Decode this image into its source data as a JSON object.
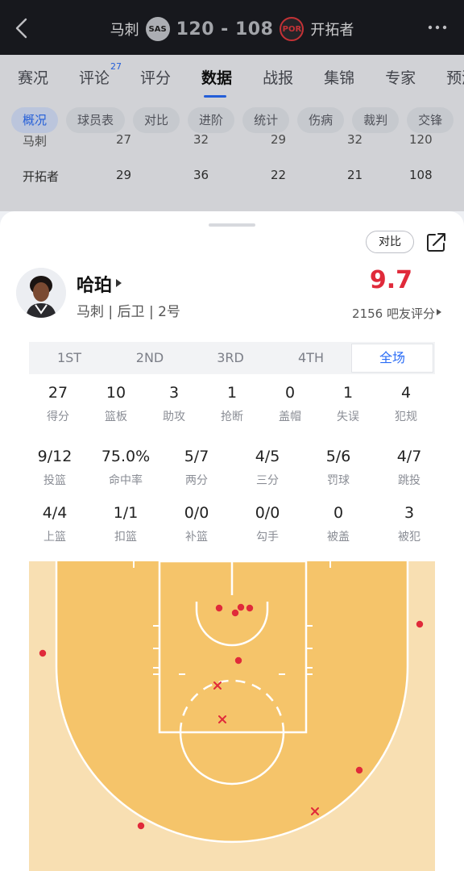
{
  "header": {
    "home_team": "马刺",
    "home_logo": "SAS",
    "score": "120 - 108",
    "away_logo": "POR",
    "away_team": "开拓者"
  },
  "main_tabs": [
    {
      "label": "赛况"
    },
    {
      "label": "评论",
      "badge": "27"
    },
    {
      "label": "评分"
    },
    {
      "label": "数据",
      "active": true
    },
    {
      "label": "战报"
    },
    {
      "label": "集锦"
    },
    {
      "label": "专家"
    },
    {
      "label": "预测"
    }
  ],
  "sub_tabs": [
    {
      "label": "概况",
      "active": true
    },
    {
      "label": "球员表"
    },
    {
      "label": "对比"
    },
    {
      "label": "进阶"
    },
    {
      "label": "统计"
    },
    {
      "label": "伤病"
    },
    {
      "label": "裁判"
    },
    {
      "label": "交锋"
    }
  ],
  "bg_table": {
    "row_clipped": {
      "team": "马刺",
      "values": [
        "27",
        "32",
        "29",
        "32",
        "120"
      ]
    },
    "row_por": {
      "team": "开拓者",
      "values": [
        "29",
        "36",
        "22",
        "21",
        "108"
      ]
    }
  },
  "sheet": {
    "compare_label": "对比",
    "player_name": "哈珀",
    "player_meta": "马刺 | 后卫 | 2号",
    "rating": "9.7",
    "rating_sub": "2156 吧友评分",
    "periods": [
      {
        "label": "1ST"
      },
      {
        "label": "2ND"
      },
      {
        "label": "3RD"
      },
      {
        "label": "4TH"
      },
      {
        "label": "全场",
        "active": true
      }
    ],
    "stats_row1": [
      {
        "value": "27",
        "label": "得分"
      },
      {
        "value": "10",
        "label": "篮板"
      },
      {
        "value": "3",
        "label": "助攻"
      },
      {
        "value": "1",
        "label": "抢断"
      },
      {
        "value": "0",
        "label": "盖帽"
      },
      {
        "value": "1",
        "label": "失误"
      },
      {
        "value": "4",
        "label": "犯规"
      }
    ],
    "stats_row2": [
      {
        "value": "9/12",
        "label": "投篮"
      },
      {
        "value": "75.0%",
        "label": "命中率"
      },
      {
        "value": "5/7",
        "label": "两分"
      },
      {
        "value": "4/5",
        "label": "三分"
      },
      {
        "value": "5/6",
        "label": "罚球"
      },
      {
        "value": "4/7",
        "label": "跳投"
      }
    ],
    "stats_row3": [
      {
        "value": "4/4",
        "label": "上篮"
      },
      {
        "value": "1/1",
        "label": "扣篮"
      },
      {
        "value": "0/0",
        "label": "补篮"
      },
      {
        "value": "0/0",
        "label": "勾手"
      },
      {
        "value": "0",
        "label": "被盖"
      },
      {
        "value": "3",
        "label": "被犯"
      }
    ]
  },
  "colors": {
    "accent": "#2a6cf6",
    "rating": "#e02a3a",
    "court_paint": "#f5c46a",
    "court_outer": "#f8dfb2",
    "made_shot": "#e02a3a",
    "missed_shot": "#e02a3a"
  },
  "icons": [
    "back-icon",
    "more-icon",
    "share-icon",
    "caret-right-icon"
  ]
}
